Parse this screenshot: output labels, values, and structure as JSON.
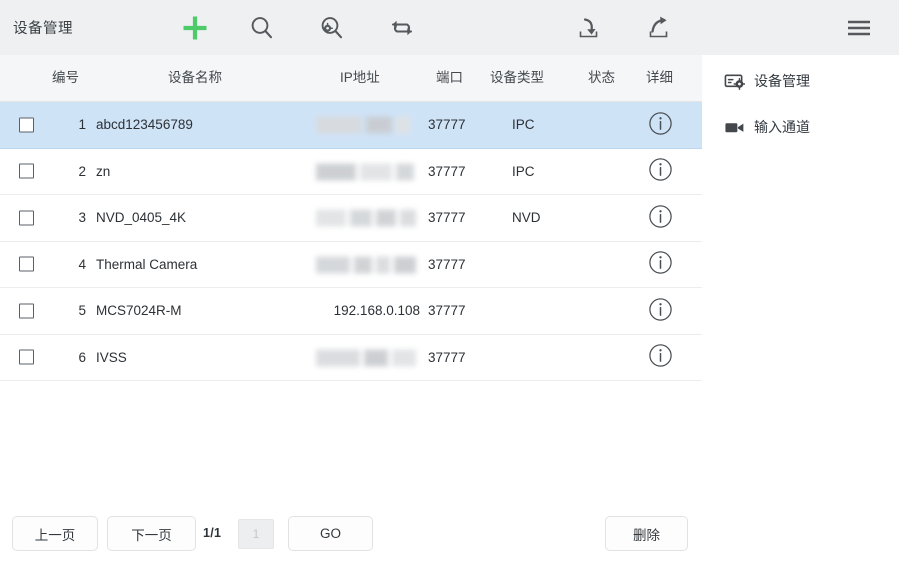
{
  "toolbar": {
    "title": "设备管理",
    "icons": [
      {
        "name": "add-icon",
        "label": "添加",
        "color": "#4ccb68"
      },
      {
        "name": "search-icon",
        "label": "搜索",
        "color": "#55595d"
      },
      {
        "name": "advanced-search-icon",
        "label": "高级搜索",
        "color": "#55595d"
      },
      {
        "name": "refresh-icon",
        "label": "刷新",
        "color": "#55595d"
      },
      {
        "name": "import-icon",
        "label": "导入",
        "color": "#55595d"
      },
      {
        "name": "export-icon",
        "label": "导出",
        "color": "#55595d"
      },
      {
        "name": "menu-icon",
        "label": "菜单",
        "color": "#55595d"
      }
    ]
  },
  "table": {
    "headers": {
      "no": "编号",
      "name": "设备名称",
      "ip": "IP地址",
      "port": "端口",
      "type": "设备类型",
      "state": "状态",
      "detail": "详细"
    },
    "rows": [
      {
        "no": "1",
        "name": "abcd123456789",
        "ip": "",
        "ip_redacted": true,
        "port": "37777",
        "type": "IPC",
        "state": "",
        "selected": true
      },
      {
        "no": "2",
        "name": "zn",
        "ip": "",
        "ip_redacted": true,
        "port": "37777",
        "type": "IPC",
        "state": "",
        "selected": false
      },
      {
        "no": "3",
        "name": "NVD_0405_4K",
        "ip": "",
        "ip_redacted": true,
        "port": "37777",
        "type": "NVD",
        "state": "",
        "selected": false
      },
      {
        "no": "4",
        "name": "Thermal Camera",
        "ip": "",
        "ip_redacted": true,
        "port": "37777",
        "type": "",
        "state": "",
        "selected": false
      },
      {
        "no": "5",
        "name": "MCS7024R-M",
        "ip": "192.168.0.108",
        "ip_redacted": false,
        "port": "37777",
        "type": "",
        "state": "",
        "selected": false
      },
      {
        "no": "6",
        "name": "IVSS",
        "ip": "",
        "ip_redacted": true,
        "port": "37777",
        "type": "",
        "state": "",
        "selected": false
      }
    ]
  },
  "sidebar": {
    "items": [
      {
        "label": "设备管理",
        "icon": "device-manage-icon"
      },
      {
        "label": "输入通道",
        "icon": "video-camera-icon"
      }
    ]
  },
  "pagination": {
    "prev_label": "上一页",
    "next_label": "下一页",
    "page_indicator": "1/1",
    "page_input_value": "",
    "page_input_placeholder": "1",
    "go_label": "GO",
    "delete_label": "删除"
  },
  "colors": {
    "toolbar_bg": "#eef0f1",
    "accent_green": "#4ccb68",
    "row_selected_bg": "#cfe3f7",
    "header_bg": "#f5f6f7",
    "icon_gray": "#55595d"
  }
}
